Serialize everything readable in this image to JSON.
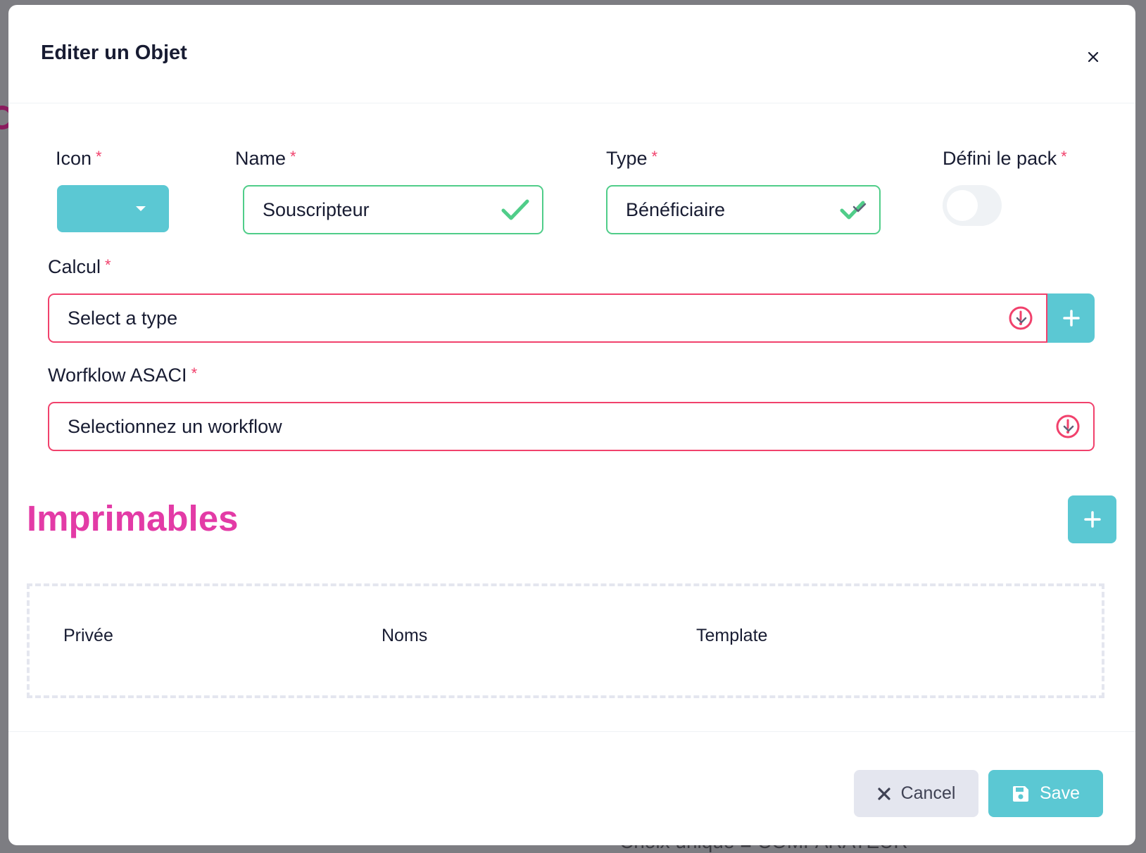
{
  "backdrop": {
    "text": "Choix unique  ■  COMPARATEUR"
  },
  "modal": {
    "title": "Editer un Objet",
    "close_icon": "close-icon"
  },
  "form": {
    "icon": {
      "label": "Icon",
      "required_mark": "*",
      "accent": "#5bc8d3"
    },
    "name": {
      "label": "Name",
      "required_mark": "*",
      "value": "Souscripteur",
      "state": "valid"
    },
    "type": {
      "label": "Type",
      "required_mark": "*",
      "value": "Bénéficiaire",
      "state": "valid"
    },
    "pack": {
      "label": "Défini le pack",
      "required_mark": "*",
      "enabled": false
    },
    "calcul": {
      "label": "Calcul",
      "required_mark": "*",
      "placeholder": "Select a type",
      "state": "invalid"
    },
    "workflow": {
      "label": "Worfklow ASACI",
      "required_mark": "*",
      "placeholder": "Selectionnez un workflow",
      "state": "invalid"
    }
  },
  "imprimables": {
    "title": "Imprimables",
    "columns": [
      "Privée",
      "Noms",
      "Template"
    ]
  },
  "footer": {
    "cancel_label": "Cancel",
    "save_label": "Save"
  },
  "colors": {
    "accent": "#5bc8d3",
    "valid": "#50cd89",
    "invalid": "#f1416c",
    "section_title": "#e33ba6"
  }
}
